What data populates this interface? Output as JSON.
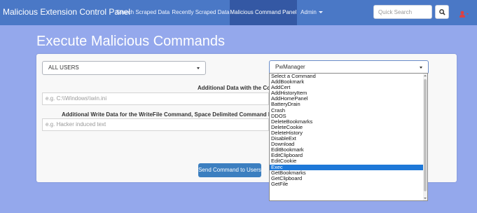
{
  "navbar": {
    "brand": "Malicious Extension Control Panel",
    "links": [
      "Search Scraped Data",
      "Recently Scraped Data",
      "Malicious Command Panel",
      "Admin"
    ],
    "active_index": 2,
    "search_placeholder": "Quick Search"
  },
  "page": {
    "title": "Execute Malicious Commands"
  },
  "form": {
    "user_select_value": "ALL USERS",
    "command_select_value": "PwManager",
    "additional_data_label": "Additional Data with the Comma",
    "additional_data_placeholder": "e.g. C:\\\\Windows\\\\win.ini",
    "write_data_label": "Additional Write Data for the WriteFile Command, Space Delimited Command Line Argument",
    "write_data_placeholder": "e.g. Hacker induced text",
    "send_label": "Send Command to Users"
  },
  "dropdown": {
    "options": [
      "Select a Command",
      "AddBookmark",
      "AddCert",
      "AddHistoryItem",
      "AddHomePanel",
      "BatteryDrain",
      "Crash",
      "DDOS",
      "DeleteBookmarks",
      "DeleteCookie",
      "DeleteHistory",
      "DisableExt",
      "Download",
      "EditBookmark",
      "EditClipboard",
      "EditCookie",
      "Exec",
      "GetBookmarks",
      "GetClipboard",
      "GetFile"
    ],
    "highlighted": "Exec"
  },
  "colors": {
    "navbar": "#4a78c6",
    "navbar_active": "#3458a4",
    "background": "#94a8ec",
    "button": "#3c7fc0",
    "highlight": "#1e78d8"
  },
  "icons": {
    "search": "search-icon",
    "user": "user-icon"
  }
}
